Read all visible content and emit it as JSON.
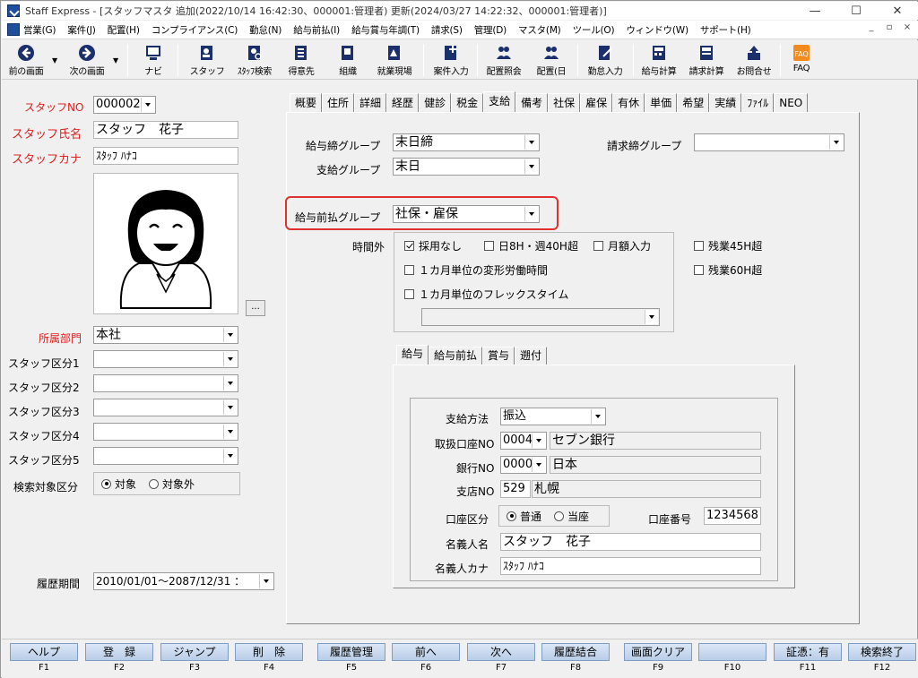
{
  "window": {
    "title": "Staff Express - [スタッフマスタ 追加(2022/10/14 16:42:30、000001:管理者) 更新(2024/03/27 14:22:32、000001:管理者)]",
    "min": "—",
    "max": "☐",
    "close": "✕"
  },
  "menu": [
    "営業(G)",
    "案件(J)",
    "配置(H)",
    "コンプライアンス(C)",
    "勤怠(N)",
    "給与前払(I)",
    "給与賞与年調(T)",
    "請求(S)",
    "管理(D)",
    "マスタ(M)",
    "ツール(O)",
    "ウィンドウ(W)",
    "サポート(H)"
  ],
  "mdi": {
    "min": "_",
    "restore": "▫",
    "close": "×"
  },
  "toolbar": {
    "prev": "前の画面",
    "next": "次の画面",
    "navi": "ナビ",
    "staff": "スタッフ",
    "staff_search": "ｽﾀｯﾌ検索",
    "client": "得意先",
    "org": "組織",
    "site": "就業現場",
    "case_input": "案件入力",
    "assign_ref": "配置照会",
    "assign_day": "配置(日",
    "attendance": "勤怠入力",
    "payroll": "給与計算",
    "billing": "請求計算",
    "inquiry": "お問合せ",
    "faq": "FAQ"
  },
  "left": {
    "staff_no_label": "スタッフNO",
    "staff_no": "000002",
    "staff_name_label": "スタッフ氏名",
    "staff_name": "スタッフ　花子",
    "staff_kana_label": "スタッフカナ",
    "staff_kana": "ｽﾀｯﾌ ﾊﾅｺ",
    "photo_btn": "...",
    "dept_label": "所属部門",
    "dept": "本社",
    "cat1_label": "スタッフ区分1",
    "cat2_label": "スタッフ区分2",
    "cat3_label": "スタッフ区分3",
    "cat4_label": "スタッフ区分4",
    "cat5_label": "スタッフ区分5",
    "search_label": "検索対象区分",
    "search_on": "対象",
    "search_off": "対象外",
    "history_label": "履歴期間",
    "history": "2010/01/01～2087/12/31 ："
  },
  "tabs": [
    "概要",
    "住所",
    "詳細",
    "経歴",
    "健診",
    "税金",
    "支給",
    "備考",
    "社保",
    "雇保",
    "有休",
    "単価",
    "希望",
    "実績",
    "ﾌｧｲﾙ",
    "NEO"
  ],
  "pay": {
    "close_group_label": "給与締グループ",
    "close_group": "末日締",
    "pay_group_label": "支給グループ",
    "pay_group": "末日",
    "billing_close_label": "請求締グループ",
    "billing_close": "",
    "advance_group_label": "給与前払グループ",
    "advance_group": "社保・雇保",
    "overtime_label": "時間外",
    "ot_adopt": "採用なし",
    "ot_day8": "日8H・週40H超",
    "ot_monthly": "月額入力",
    "ot_45": "残業45H超",
    "ot_60": "残業60H超",
    "ot_1month": "１カ月単位の変形労働時間",
    "ot_flex": "１カ月単位のフレックスタイム"
  },
  "subtabs": [
    "給与",
    "給与前払",
    "賞与",
    "遡付"
  ],
  "payment": {
    "method_label": "支給方法",
    "method": "振込",
    "bank_no_label": "取扱口座NO",
    "bank_no": "0004",
    "bank_no_name": "セブン銀行",
    "bank_label": "銀行NO",
    "bank_code": "0000",
    "bank_name": "日本",
    "branch_label": "支店NO",
    "branch_code": "529",
    "branch_name": "札幌",
    "account_type_label": "口座区分",
    "account_normal": "普通",
    "account_current": "当座",
    "account_no_label": "口座番号",
    "account_no": "1234568",
    "holder_label": "名義人名",
    "holder": "スタッフ　花子",
    "holder_kana_label": "名義人カナ",
    "holder_kana": "ｽﾀｯﾌ ﾊﾅｺ"
  },
  "fkeys": [
    {
      "label": "ヘルプ",
      "key": "F1"
    },
    {
      "label": "登　録",
      "key": "F2"
    },
    {
      "label": "ジャンプ",
      "key": "F3"
    },
    {
      "label": "削　除",
      "key": "F4"
    },
    {
      "label": "履歴管理",
      "key": "F5"
    },
    {
      "label": "前へ",
      "key": "F6"
    },
    {
      "label": "次へ",
      "key": "F7"
    },
    {
      "label": "履歴結合",
      "key": "F8"
    },
    {
      "label": "画面クリア",
      "key": "F9"
    },
    {
      "label": "",
      "key": "F10"
    },
    {
      "label": "証憑：有",
      "key": "F11"
    },
    {
      "label": "検索終了",
      "key": "F12"
    }
  ],
  "colors": {
    "required_label": "#e02020",
    "highlight": "#e03030",
    "fkey_bg": "#c6d7ee"
  }
}
